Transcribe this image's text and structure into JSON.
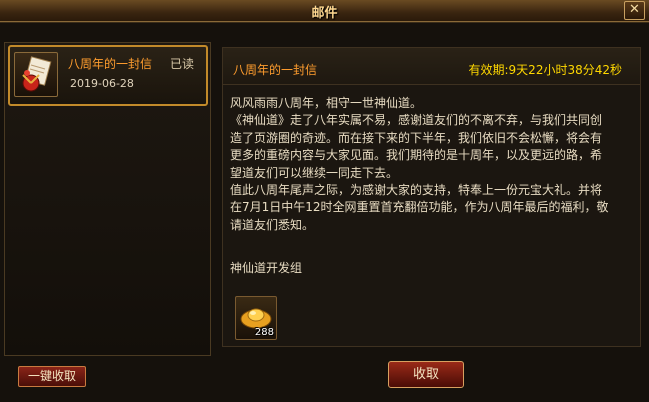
{
  "window": {
    "title": "邮件",
    "close_label": "✕"
  },
  "mail_list": [
    {
      "subject": "八周年的一封信",
      "status": "已读",
      "date": "2019-06-28",
      "icon": "letter-gift-icon"
    }
  ],
  "detail": {
    "subject": "八周年的一封信",
    "validity": "有效期:9天22小时38分42秒",
    "lines": [
      "风风雨雨八周年，相守一世神仙道。",
      "《神仙道》走了八年实属不易，感谢道友们的不离不弃，与我们共同创",
      "造了页游圈的奇迹。而在接下来的下半年，我们依旧不会松懈，将会有",
      "更多的重磅内容与大家见面。我们期待的是十周年，以及更远的路，希",
      "望道友们可以继续一同走下去。",
      "值此八周年尾声之际，为感谢大家的支持，特奉上一份元宝大礼。并将",
      "在7月1日中午12时全网重置首充翻倍功能，作为八周年最后的福利，敬",
      "请道友们悉知。"
    ],
    "signature": "神仙道开发组",
    "attachment": {
      "icon": "gold-ingot-icon",
      "count": "288"
    }
  },
  "buttons": {
    "collect_all": "一键收取",
    "collect": "收取"
  }
}
